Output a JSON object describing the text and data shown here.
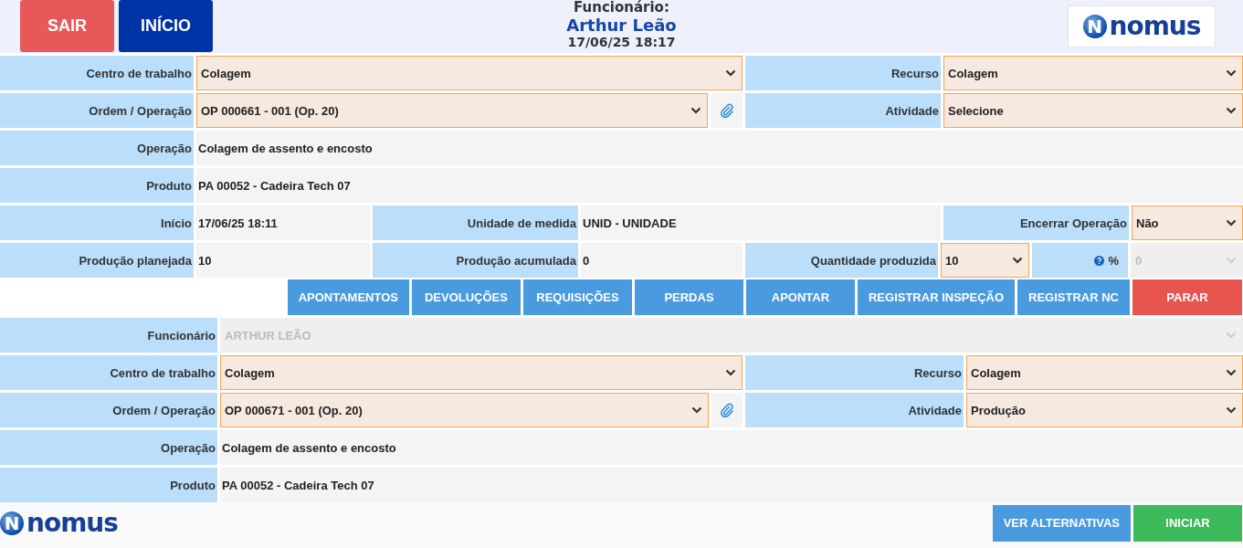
{
  "header": {
    "buttons": [
      {
        "label": "SAIR",
        "kind": "danger"
      },
      {
        "label": "INÍCIO",
        "kind": "dark"
      }
    ],
    "employee_label": "Funcionário:",
    "employee_name": "Arthur Leão",
    "datetime": "17/06/25 18:17",
    "logo": {
      "mark": "N",
      "text": "nomus"
    }
  },
  "section_1": {
    "rows": [
      {
        "fields": [
          {
            "label": "Centro de trabalho",
            "select": {
              "value": "Colagem",
              "disabled": false
            }
          },
          {
            "label": "Recurso",
            "select": {
              "value": "Colagem",
              "disabled": false
            }
          }
        ]
      },
      {
        "fields": [
          {
            "label": "Ordem / Operação",
            "select": {
              "value": "OP 000661 - 001 (Op. 20)",
              "disabled": false
            },
            "attachment": true
          },
          {
            "label": "Atividade",
            "select": {
              "value": "Selecione",
              "disabled": false
            }
          }
        ]
      },
      {
        "fields": [
          {
            "label": "Operação",
            "value": "Colagem de assento e encosto"
          }
        ]
      },
      {
        "fields": [
          {
            "label": "Produto",
            "value": "PA 00052 - Cadeira Tech 07"
          }
        ]
      },
      {
        "fields": [
          {
            "label": "Início",
            "value": "17/06/25 18:11"
          },
          {
            "label": "Unidade de medida",
            "value": "UNID - UNIDADE"
          },
          {
            "label": "Encerrar Operação",
            "select": {
              "value": "Não",
              "disabled": false
            }
          }
        ]
      },
      {
        "fields": [
          {
            "label": "Produção planejada",
            "value": "10"
          },
          {
            "label": "Produção acumulada",
            "value": "0"
          },
          {
            "label": "Quantidade produzida",
            "select": {
              "value": "10",
              "disabled": false
            }
          },
          {
            "label": "%",
            "help": true,
            "select": {
              "value": "0",
              "disabled": true
            }
          }
        ]
      }
    ]
  },
  "actions": [
    {
      "label": "APONTAMENTOS",
      "kind": "primary"
    },
    {
      "label": "DEVOLUÇÕES",
      "kind": "primary"
    },
    {
      "label": "REQUISIÇÕES",
      "kind": "primary"
    },
    {
      "label": "PERDAS",
      "kind": "primary"
    },
    {
      "label": "APONTAR",
      "kind": "primary"
    },
    {
      "label": "REGISTRAR INSPEÇÃO",
      "kind": "primary"
    },
    {
      "label": "REGISTRAR NC",
      "kind": "primary"
    },
    {
      "label": "PARAR",
      "kind": "danger"
    }
  ],
  "section_2": {
    "rows": [
      {
        "fields": [
          {
            "label": "Funcionário",
            "select": {
              "value": "ARTHUR LEÃO",
              "disabled": true
            }
          }
        ]
      },
      {
        "fields": [
          {
            "label": "Centro de trabalho",
            "select": {
              "value": "Colagem",
              "disabled": false
            }
          },
          {
            "label": "Recurso",
            "select": {
              "value": "Colagem",
              "disabled": false
            }
          }
        ]
      },
      {
        "fields": [
          {
            "label": "Ordem / Operação",
            "select": {
              "value": "OP 000671 - 001 (Op. 20)",
              "disabled": false
            },
            "attachment": true
          },
          {
            "label": "Atividade",
            "select": {
              "value": "Produção",
              "disabled": false
            }
          }
        ]
      },
      {
        "fields": [
          {
            "label": "Operação",
            "value": "Colagem de assento e encosto"
          }
        ]
      },
      {
        "fields": [
          {
            "label": "Produto",
            "value": "PA 00052 - Cadeira Tech 07"
          }
        ]
      }
    ]
  },
  "footer": {
    "logo": {
      "mark": "N",
      "text": "nomus"
    },
    "buttons": [
      {
        "label": "VER ALTERNATIVAS",
        "kind": "primary"
      },
      {
        "label": "INICIAR",
        "kind": "success"
      }
    ]
  }
}
